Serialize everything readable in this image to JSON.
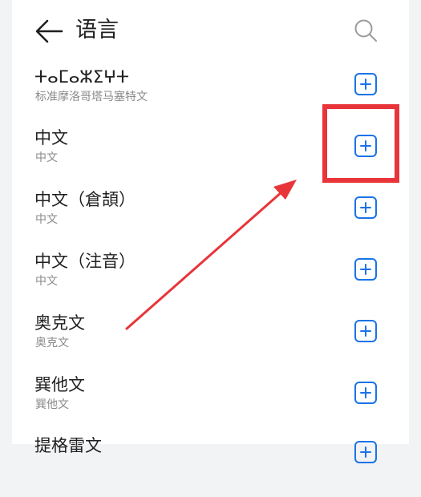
{
  "header": {
    "title": "语言",
    "back_icon": "back-arrow-icon",
    "search_icon": "search-icon"
  },
  "languages": [
    {
      "name": "ⵜⴰⵎⴰⵣⵉⵖⵜ",
      "sub": "标准摩洛哥塔马塞特文"
    },
    {
      "name": "中文",
      "sub": "中文"
    },
    {
      "name": "中文（倉頡）",
      "sub": "中文"
    },
    {
      "name": "中文（注音）",
      "sub": "中文"
    },
    {
      "name": "奥克文",
      "sub": "奥克文"
    },
    {
      "name": "巽他文",
      "sub": "巽他文"
    },
    {
      "name": "提格雷文",
      "sub": ""
    }
  ],
  "colors": {
    "accent": "#1a73e8",
    "annotation": "#e8353a"
  }
}
